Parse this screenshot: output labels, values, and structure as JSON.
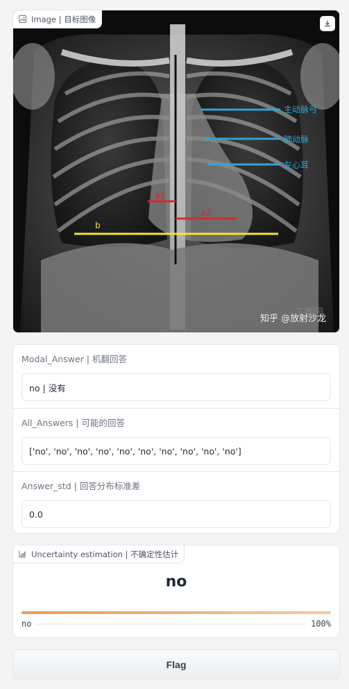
{
  "image_panel": {
    "label": "Image | 目标图像",
    "annotations": {
      "aorta": "主动脉弓",
      "pulmonary": "肺动脉",
      "left_atrium": "左心耳",
      "a1": "a1",
      "a2": "a2",
      "b": "b"
    },
    "watermark": "知乎 @放射沙龙",
    "watermark_logo": "丁香园"
  },
  "answers": {
    "modal_answer": {
      "label": "Modal_Answer | 机翻回答",
      "value": "no | 没有"
    },
    "all_answers": {
      "label": "All_Answers | 可能的回答",
      "value": "['no', 'no', 'no', 'no', 'no', 'no', 'no', 'no', 'no', 'no']"
    },
    "answer_std": {
      "label": "Answer_std | 回答分布标准差",
      "value": "0.0"
    }
  },
  "uncertainty": {
    "label": "Uncertainty estimation | 不确定性估计",
    "top_label": "no",
    "confidences": [
      {
        "label": "no",
        "percent": "100%",
        "fraction": 1.0
      }
    ]
  },
  "flag_button": {
    "label": "Flag"
  },
  "colors": {
    "accent_bar": "#ea9a52",
    "line_blue": "#2aa7d8",
    "line_red": "#d42a2a",
    "line_yellow": "#f1e534"
  }
}
